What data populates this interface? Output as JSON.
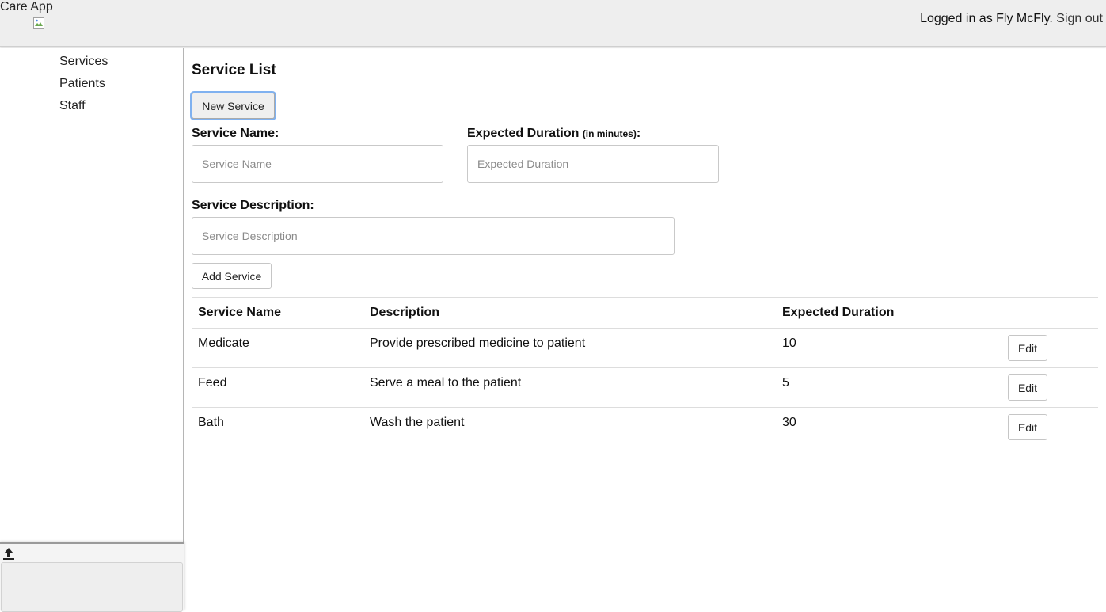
{
  "header": {
    "app_title": "Care App",
    "logged_in_text": "Logged in as Fly McFly.",
    "sign_out_label": "Sign out"
  },
  "sidebar": {
    "items": [
      {
        "label": "Services"
      },
      {
        "label": "Patients"
      },
      {
        "label": "Staff"
      }
    ]
  },
  "main": {
    "title": "Service List",
    "new_service_label": "New Service",
    "form": {
      "service_name_label": "Service Name:",
      "service_name_placeholder": "Service Name",
      "duration_label": "Expected Duration",
      "duration_unit": "(in minutes)",
      "duration_colon": ":",
      "duration_placeholder": "Expected Duration",
      "description_label": "Service Description:",
      "description_placeholder": "Service Description",
      "add_label": "Add Service"
    },
    "table": {
      "headers": [
        "Service Name",
        "Description",
        "Expected Duration"
      ],
      "rows": [
        {
          "name": "Medicate",
          "description": "Provide prescribed medicine to patient",
          "duration": "10",
          "edit_label": "Edit"
        },
        {
          "name": "Feed",
          "description": "Serve a meal to the patient",
          "duration": "5",
          "edit_label": "Edit"
        },
        {
          "name": "Bath",
          "description": "Wash the patient",
          "duration": "30",
          "edit_label": "Edit"
        }
      ]
    }
  }
}
